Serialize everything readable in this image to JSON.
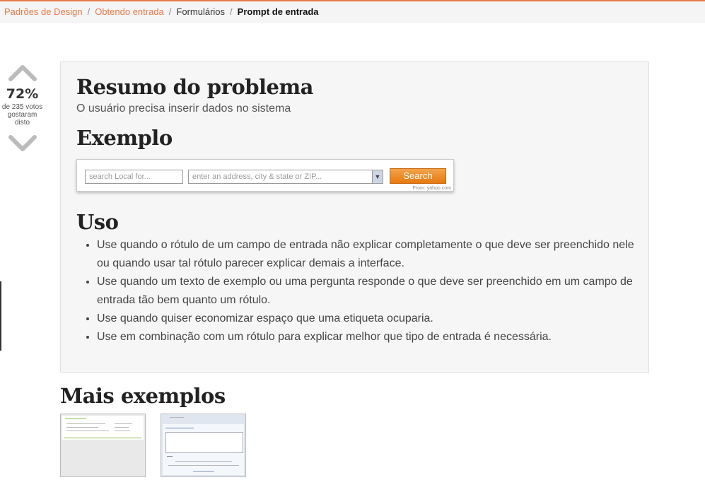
{
  "breadcrumb": {
    "items": [
      "Padrões de Design",
      "Obtendo entrada",
      "Formulários"
    ],
    "separator": "/",
    "current": "Prompt de entrada"
  },
  "vote": {
    "percent": "72%",
    "votes_line1": "de 235 votos",
    "votes_line2": "gostaram",
    "votes_line3": "disto",
    "up_icon": "chevron-up-icon",
    "down_icon": "chevron-down-icon"
  },
  "panel": {
    "summary_title": "Resumo do problema",
    "summary_text": "O usuário precisa inserir dados no sistema",
    "example_title": "Exemplo",
    "example_image": {
      "field1_placeholder": "search Local for...",
      "field2_placeholder": "enter an address, city & state or ZIP...",
      "button_label": "Search",
      "source": "From: yahoo.com"
    },
    "usage_title": "Uso",
    "usage_items": [
      "Use quando o rótulo de um campo de entrada não explicar completamente o que deve ser preenchido nele ou quando usar tal rótulo parecer explicar demais a interface.",
      "Use quando um texto de exemplo ou uma pergunta responde o que deve ser preenchido em um campo de entrada tão bem quanto um rótulo.",
      "Use quando quiser economizar espaço que uma etiqueta ocuparia.",
      "Use em combinação com um rótulo para explicar melhor que tipo de entrada é necessária."
    ]
  },
  "more": {
    "title": "Mais exemplos"
  },
  "colors": {
    "accent": "#e8794a",
    "panel_bg": "#f6f6f6",
    "search_button": "#e57a10"
  }
}
